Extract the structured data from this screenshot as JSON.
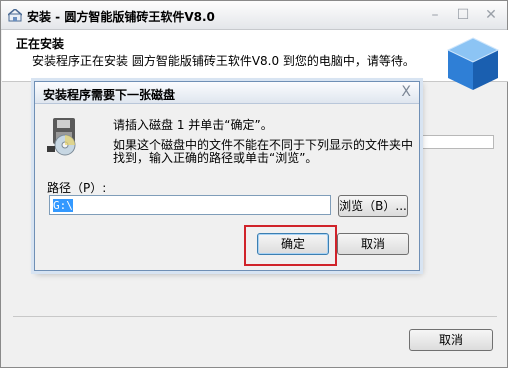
{
  "window": {
    "title": "安装 - 圆方智能版铺砖王软件V8.0",
    "minimize_glyph": "–",
    "maximize_glyph": "☐",
    "close_glyph": "✕"
  },
  "header": {
    "title": "正在安装",
    "description": "安装程序正在安装 圆方智能版铺砖王软件V8.0 到您的电脑中，请等待。"
  },
  "footer": {
    "cancel_label": "取消"
  },
  "dialog": {
    "title": "安装程序需要下一张磁盘",
    "close_glyph": "X",
    "message1": "请插入磁盘 1 并单击“确定”。",
    "message2": "如果这个磁盘中的文件不能在不同于下列显示的文件夹中找到，输入正确的路径或单击“浏览”。",
    "path_label": "路径（P）:",
    "path_value": "G:\\",
    "browse_label": "浏览（B）...",
    "ok_label": "确定",
    "cancel_label": "取消"
  },
  "icons": [
    "app-icon",
    "cube-logo-icon",
    "disk-drive-icon"
  ],
  "colors": {
    "highlight": "#d0232a",
    "selection": "#3399ff",
    "cube": "#2f7fd6"
  }
}
